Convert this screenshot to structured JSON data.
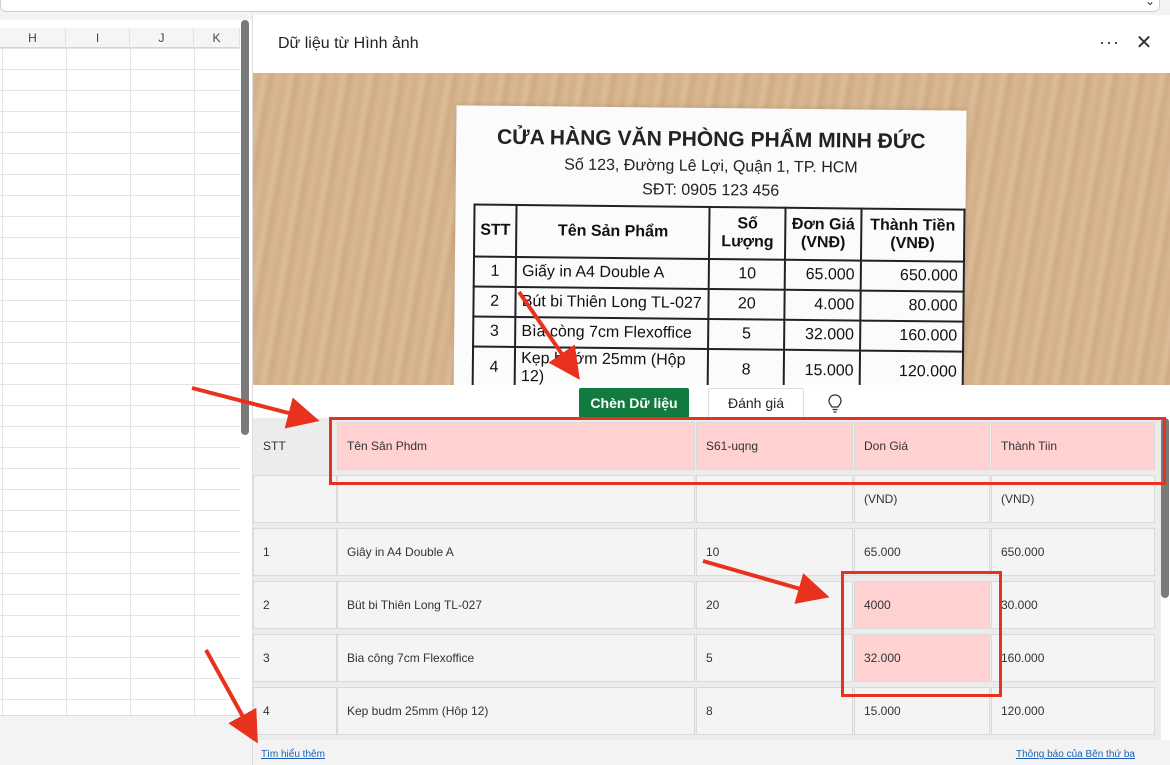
{
  "spreadsheet": {
    "columns": [
      "H",
      "I",
      "J",
      "K"
    ]
  },
  "panel": {
    "title": "Dữ liệu từ Hình ảnh",
    "more_icon": "ellipsis-icon",
    "close_icon": "close-icon"
  },
  "photo": {
    "shop_name": "CỬA HÀNG VĂN PHÒNG PHẨM MINH ĐỨC",
    "address": "Số 123, Đường Lê Lợi, Quận 1, TP. HCM",
    "phone": "SĐT: 0905 123 456",
    "headers": [
      "STT",
      "Tên Sản Phẩm",
      "Số Lượng",
      "Đơn Giá (VNĐ)",
      "Thành Tiền (VNĐ)"
    ],
    "rows": [
      [
        "1",
        "Giấy in A4 Double A",
        "10",
        "65.000",
        "650.000"
      ],
      [
        "2",
        "Bút bi Thiên Long TL-027",
        "20",
        "4.000",
        "80.000"
      ],
      [
        "3",
        "Bìa còng 7cm Flexoffice",
        "5",
        "32.000",
        "160.000"
      ],
      [
        "4",
        "Kẹp bướm 25mm (Hộp 12)",
        "8",
        "15.000",
        "120.000"
      ]
    ]
  },
  "actions": {
    "insert_label": "Chèn Dữ liệu",
    "rate_label": "Đánh giá",
    "idea_icon": "lightbulb-icon"
  },
  "result": {
    "rows": [
      [
        "STT",
        "Tên Sân Phdm",
        "S61-uqng",
        "Don Giá",
        "Thành Tiin"
      ],
      [
        "",
        "",
        "",
        "(VND)",
        "(VND)"
      ],
      [
        "1",
        "Giây in A4 Double A",
        "10",
        "65.000",
        "650.000"
      ],
      [
        "2",
        "Büt bi Thiên Long TL-027",
        "20",
        "4000",
        "30.000"
      ],
      [
        "3",
        "Bia công 7cm Flexoffice",
        "5",
        "32.000",
        "160.000"
      ],
      [
        "4",
        "Kep budm 25mm (Hôp 12)",
        "8",
        "15.000",
        "120.000"
      ]
    ]
  },
  "footer": {
    "learn_more": "Tìm hiểu thêm",
    "third_party": "Thông báo của Bên thứ ba"
  },
  "annotation_color": "#e8321e",
  "highlight_color": "#ffd1d1",
  "insert_button_color": "#117a3f"
}
